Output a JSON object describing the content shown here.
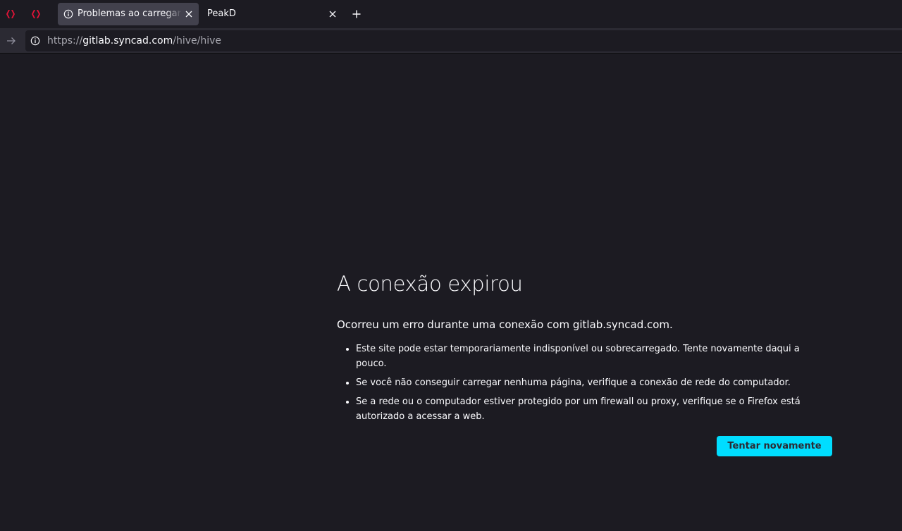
{
  "browser": {
    "pinned_tabs": [
      {
        "icon": "hive-logo-icon",
        "color": "#e31337"
      },
      {
        "icon": "hive-logo-icon",
        "color": "#e31337"
      }
    ],
    "tabs": [
      {
        "title": "Problemas ao carregar a página",
        "active": true,
        "icon": "info-icon"
      },
      {
        "title": "PeakD",
        "active": false
      }
    ],
    "url": {
      "scheme": "https://",
      "host": "gitlab.syncad.com",
      "path": "/hive/hive"
    }
  },
  "error_page": {
    "title": "A conexão expirou",
    "short_desc": "Ocorreu um erro durante uma conexão com gitlab.syncad.com.",
    "items": [
      "Este site pode estar temporariamente indisponível ou sobrecarregado. Tente novamente daqui a pouco.",
      "Se você não conseguir carregar nenhuma página, verifique a conexão de rede do computador.",
      "Se a rede ou o computador estiver protegido por um firewall ou proxy, verifique se o Firefox está autorizado a acessar a web."
    ],
    "retry_label": "Tentar novamente"
  },
  "colors": {
    "accent": "#00ddff",
    "background": "#1c1b22",
    "toolbar": "#2b2a33",
    "active_tab": "#42414d"
  }
}
